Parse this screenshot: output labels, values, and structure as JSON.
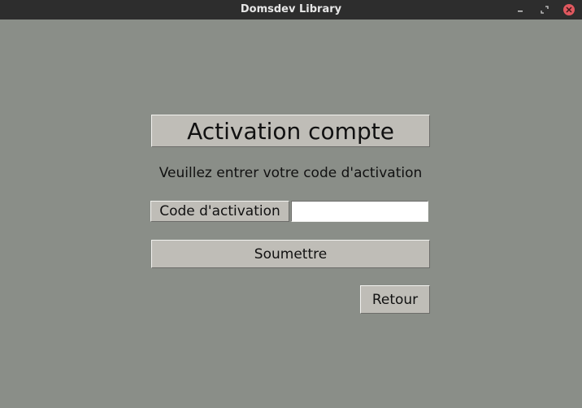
{
  "window": {
    "title": "Domsdev Library",
    "controls": {
      "minimize_icon": "minimize-icon",
      "maximize_icon": "maximize-icon",
      "close_icon": "close-icon"
    }
  },
  "form": {
    "heading": "Activation compte",
    "prompt": "Veuillez entrer votre code d'activation",
    "code_label": "Code d'activation",
    "code_value": "",
    "code_placeholder": "",
    "submit_label": "Soumettre",
    "back_label": "Retour"
  },
  "colors": {
    "background": "#8a8e88",
    "widget": "#bfbdb7",
    "titlebar": "#2d2d2d",
    "close_button": "#e0585f"
  }
}
